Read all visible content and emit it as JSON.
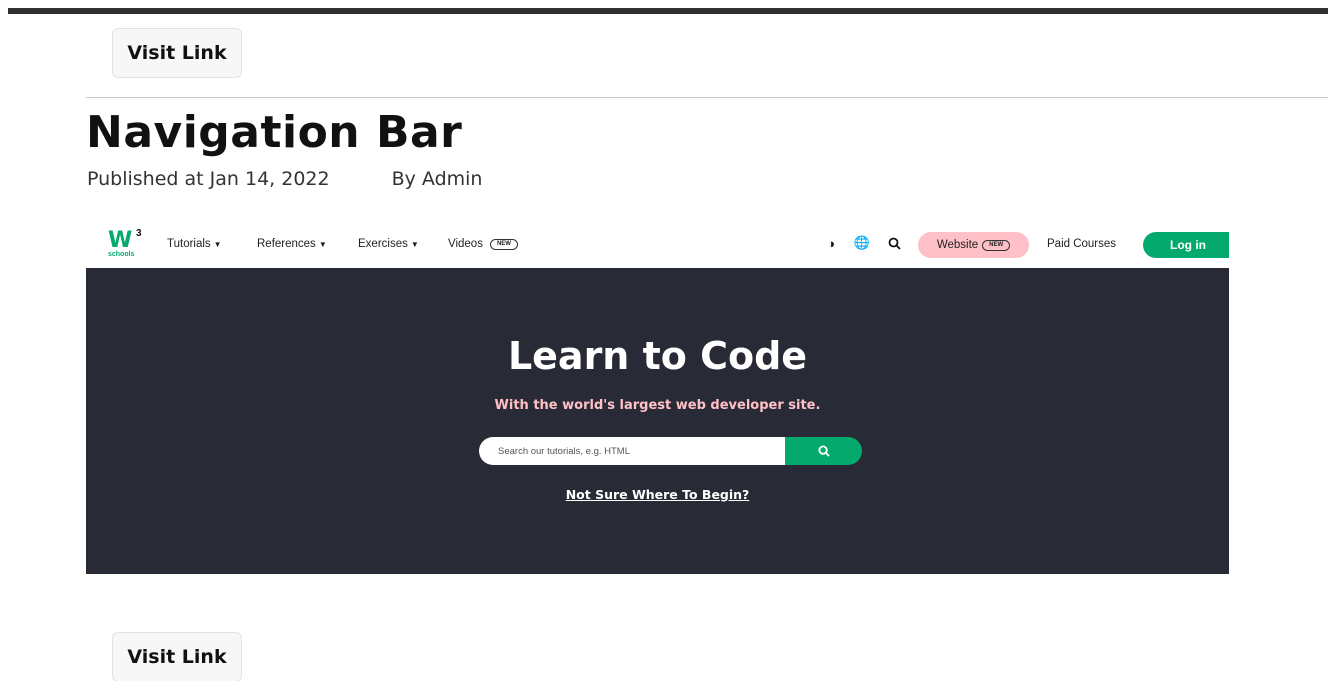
{
  "page": {
    "visit_label_top": "Visit Link",
    "visit_label_bottom": "Visit Link",
    "title": "Navigation Bar",
    "published": "Published at Jan 14, 2022",
    "author": "By Admin"
  },
  "w3_nav": {
    "logo_mark": "W",
    "logo_sup": "3",
    "logo_sub": "schools",
    "items": [
      {
        "label": "Tutorials"
      },
      {
        "label": "References"
      },
      {
        "label": "Exercises"
      }
    ],
    "videos_label": "Videos",
    "new_badge": "NEW",
    "website_label": "Website",
    "paid_courses": "Paid Courses",
    "login_label": "Log in",
    "icons": [
      "contrast-icon",
      "globe-icon",
      "search-icon"
    ]
  },
  "hero": {
    "title": "Learn to Code",
    "subtitle": "With the world's largest web developer site.",
    "search_placeholder": "Search our tutorials, e.g. HTML",
    "begin_link": "Not Sure Where To Begin?"
  },
  "colors": {
    "brand_green": "#04AA6D",
    "hero_bg": "#282A35",
    "pink": "#FFC0C7"
  }
}
